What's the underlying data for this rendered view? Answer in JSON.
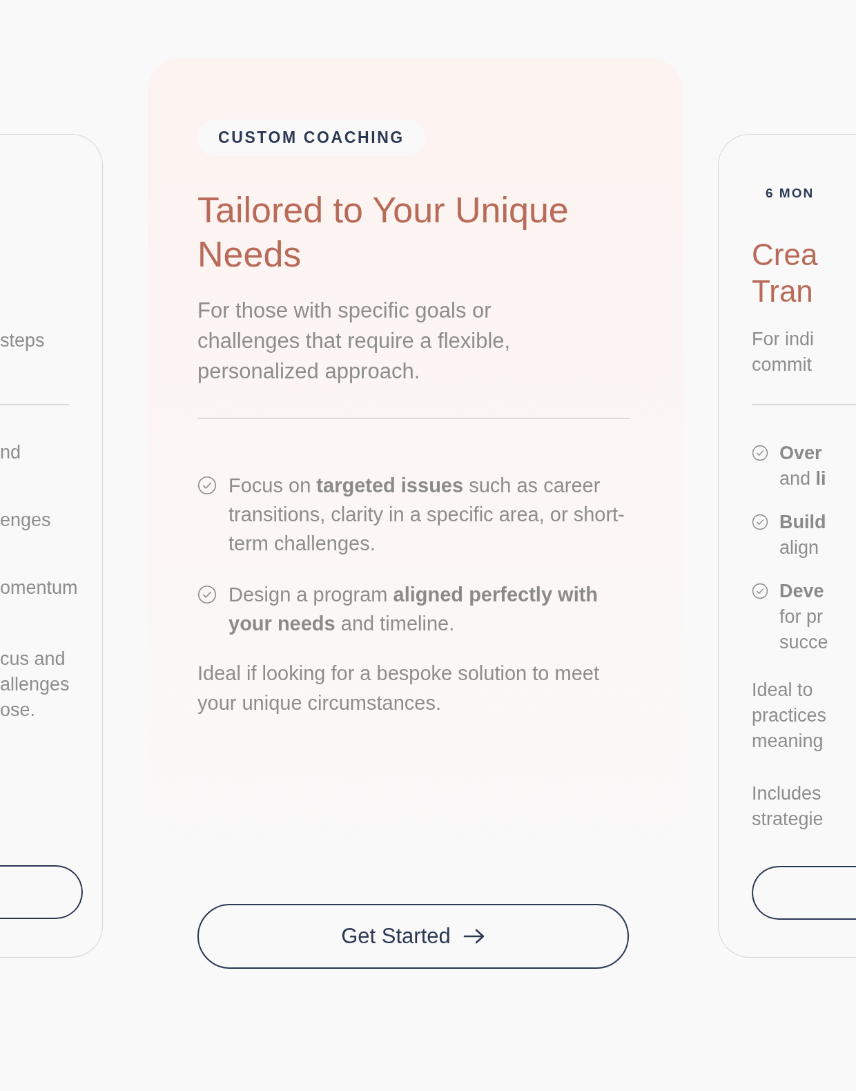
{
  "left_card": {
    "subtitle_lines": [
      "steps"
    ],
    "feature_lines": [
      "nd",
      "enges",
      "omentum"
    ],
    "note_lines": [
      "cus and",
      "allenges",
      "ose."
    ]
  },
  "featured_card": {
    "badge": "CUSTOM COACHING",
    "title": "Tailored to Your Unique Needs",
    "subtitle": "For those with specific goals or challenges that require a flexible, personalized approach.",
    "features": [
      {
        "text": "Focus on **targeted issues** such as career transitions, clarity in a specific area, or short-term challenges."
      },
      {
        "text": "Design a program **aligned perfectly with your needs** and timeline."
      }
    ],
    "note": "Ideal if looking for a bespoke solution to meet your unique circumstances.",
    "button": {
      "label": "Get Started"
    }
  },
  "right_card": {
    "badge": "6 MON",
    "title_lines": [
      "Crea",
      "Tran"
    ],
    "subtitle_lines": [
      "For indi",
      "commit"
    ],
    "features": [
      {
        "lines": [
          "**Over**",
          "and **li**"
        ]
      },
      {
        "lines": [
          "**Build**",
          "align"
        ]
      },
      {
        "lines": [
          "**Deve**",
          "for pr",
          "succe"
        ]
      }
    ],
    "notes": [
      {
        "lines": [
          "Ideal to",
          "practices",
          "meaning"
        ]
      },
      {
        "lines": [
          "Includes",
          "strategie"
        ]
      }
    ]
  }
}
